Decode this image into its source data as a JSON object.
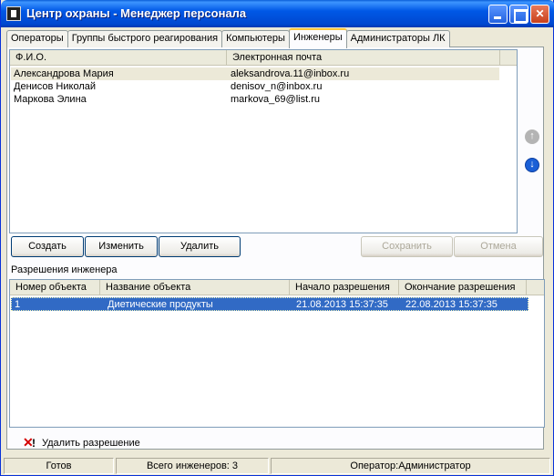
{
  "window": {
    "title": "Центр охраны - Менеджер персонала"
  },
  "tabs": [
    {
      "label": "Операторы"
    },
    {
      "label": "Группы быстрого реагирования"
    },
    {
      "label": "Компьютеры"
    },
    {
      "label": "Инженеры"
    },
    {
      "label": "Администраторы ЛК"
    }
  ],
  "engineers": {
    "columns": [
      "Ф.И.О.",
      "Электронная почта"
    ],
    "rows": [
      {
        "name": "Александрова Мария",
        "email": "aleksandrova.11@inbox.ru"
      },
      {
        "name": "Денисов Николай",
        "email": "denisov_n@inbox.ru"
      },
      {
        "name": "Маркова Элина",
        "email": "markova_69@list.ru"
      }
    ]
  },
  "buttons": {
    "create": "Создать",
    "edit": "Изменить",
    "delete": "Удалить",
    "save": "Сохранить",
    "cancel": "Отмена"
  },
  "permissions": {
    "label": "Разрешения инженера",
    "columns": [
      "Номер объекта",
      "Название объекта",
      "Начало разрешения",
      "Окончание разрешения"
    ],
    "rows": [
      {
        "number": "1",
        "name": "Диетические продукты",
        "start": "21.08.2013 15:37:35",
        "end": "22.08.2013 15:37:35"
      }
    ],
    "delete_label": "Удалить разрешение"
  },
  "status": {
    "state": "Готов",
    "total": "Всего инженеров: 3",
    "operator": "Оператор:Администратор"
  },
  "colors": {
    "selection": "#316ac5",
    "titlebar": "#0058e6",
    "panel": "#ece9d8"
  }
}
